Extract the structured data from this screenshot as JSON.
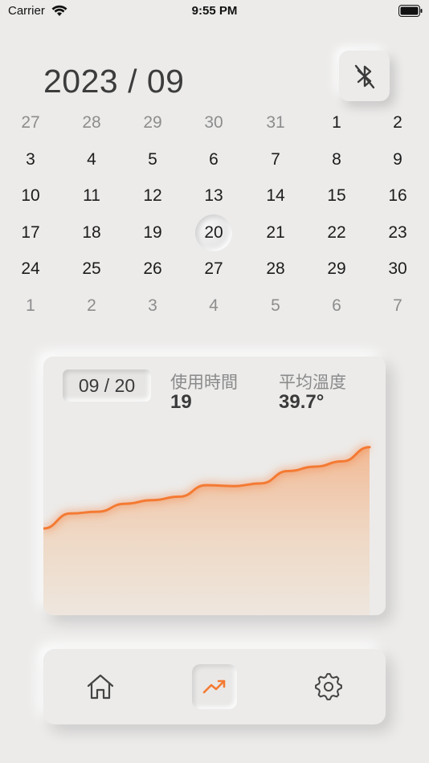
{
  "status_bar": {
    "carrier": "Carrier",
    "time": "9:55 PM"
  },
  "header": {
    "month_title": "2023 / 09",
    "bluetooth_button_icon": "bluetooth-off-icon"
  },
  "calendar": {
    "weeks": [
      [
        {
          "d": "27",
          "muted": true
        },
        {
          "d": "28",
          "muted": true
        },
        {
          "d": "29",
          "muted": true
        },
        {
          "d": "30",
          "muted": true
        },
        {
          "d": "31",
          "muted": true
        },
        {
          "d": "1",
          "muted": false
        },
        {
          "d": "2",
          "muted": false
        }
      ],
      [
        {
          "d": "3",
          "muted": false
        },
        {
          "d": "4",
          "muted": false
        },
        {
          "d": "5",
          "muted": false
        },
        {
          "d": "6",
          "muted": false
        },
        {
          "d": "7",
          "muted": false
        },
        {
          "d": "8",
          "muted": false
        },
        {
          "d": "9",
          "muted": false
        }
      ],
      [
        {
          "d": "10",
          "muted": false
        },
        {
          "d": "11",
          "muted": false
        },
        {
          "d": "12",
          "muted": false
        },
        {
          "d": "13",
          "muted": false
        },
        {
          "d": "14",
          "muted": false
        },
        {
          "d": "15",
          "muted": false
        },
        {
          "d": "16",
          "muted": false
        }
      ],
      [
        {
          "d": "17",
          "muted": false
        },
        {
          "d": "18",
          "muted": false
        },
        {
          "d": "19",
          "muted": false
        },
        {
          "d": "20",
          "muted": false,
          "selected": true
        },
        {
          "d": "21",
          "muted": false
        },
        {
          "d": "22",
          "muted": false
        },
        {
          "d": "23",
          "muted": false
        }
      ],
      [
        {
          "d": "24",
          "muted": false
        },
        {
          "d": "25",
          "muted": false
        },
        {
          "d": "26",
          "muted": false
        },
        {
          "d": "27",
          "muted": false
        },
        {
          "d": "28",
          "muted": false
        },
        {
          "d": "29",
          "muted": false
        },
        {
          "d": "30",
          "muted": false
        }
      ],
      [
        {
          "d": "1",
          "muted": true
        },
        {
          "d": "2",
          "muted": true
        },
        {
          "d": "3",
          "muted": true
        },
        {
          "d": "4",
          "muted": true
        },
        {
          "d": "5",
          "muted": true
        },
        {
          "d": "6",
          "muted": true
        },
        {
          "d": "7",
          "muted": true
        }
      ]
    ]
  },
  "detail_card": {
    "date": "09 / 20",
    "usage_label": "使用時間",
    "usage_value": "19",
    "temp_label": "平均溫度",
    "temp_value": "39.7°"
  },
  "chart_data": {
    "type": "area",
    "values": [
      0.0,
      0.17,
      0.19,
      0.28,
      0.32,
      0.36,
      0.49,
      0.48,
      0.51,
      0.65,
      0.7,
      0.76,
      0.92
    ],
    "line_color": "#f47a33",
    "fill_color": "#f4b48a"
  },
  "tabbar": {
    "tabs": [
      {
        "name": "home",
        "icon": "home-icon",
        "active": false
      },
      {
        "name": "chart",
        "icon": "trending-up-icon",
        "active": true
      },
      {
        "name": "settings",
        "icon": "gear-icon",
        "active": false
      }
    ]
  },
  "colors": {
    "background": "#ecebea",
    "accent": "#f47a33"
  }
}
